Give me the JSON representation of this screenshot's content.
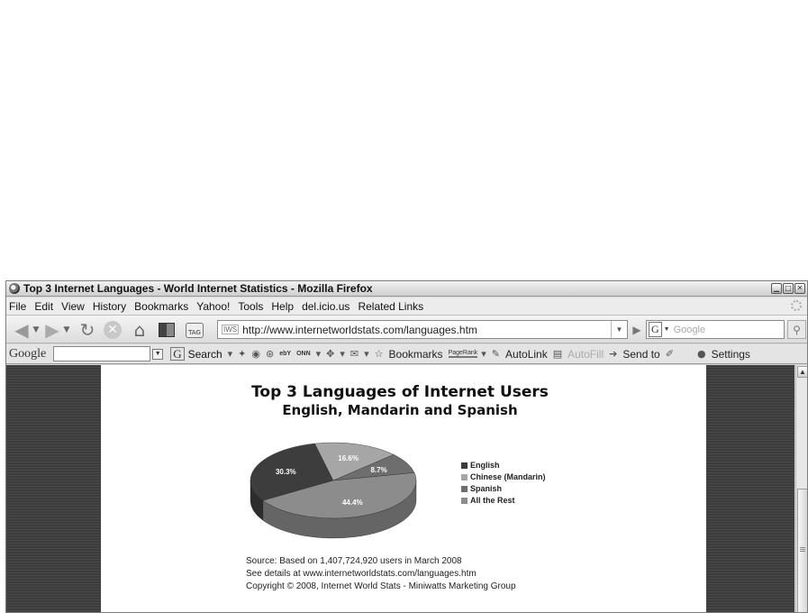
{
  "window": {
    "title": "Top 3 Internet Languages - World Internet Statistics - Mozilla Firefox",
    "buttons": [
      "minimize",
      "maximize",
      "close"
    ]
  },
  "menubar": {
    "items": [
      "File",
      "Edit",
      "View",
      "History",
      "Bookmarks",
      "Yahoo!",
      "Tools",
      "Help",
      "del.icio.us",
      "Related Links"
    ]
  },
  "navbar": {
    "site_icon": "IWS",
    "url": "http://www.internetworldstats.com/languages.htm",
    "search_engine": "G",
    "search_placeholder": "Google",
    "tag_label": "TAG"
  },
  "google_toolbar": {
    "logo": "Google",
    "search_label": "Search",
    "ebay_label": "ebY",
    "onn_label": "ONN",
    "bookmarks_label": "Bookmarks",
    "pagerank_label": "PageRank",
    "autolink_label": "AutoLink",
    "autofill_label": "AutoFill",
    "sendto_label": "Send to",
    "settings_label": "Settings"
  },
  "page": {
    "title": "Top 3 Languages of Internet Users",
    "subtitle": "English, Mandarin and Spanish",
    "source_lines": [
      "Source: Based on 1,407,724,920 users in March 2008",
      "See details at www.internetworldstats.com/languages.htm",
      "Copyright © 2008, Internet World Stats - Miniwatts Marketing Group"
    ]
  },
  "chart_data": {
    "type": "pie",
    "title": "Top 3 Languages of Internet Users",
    "subtitle": "English, Mandarin and Spanish",
    "categories": [
      "English",
      "Chinese (Mandarin)",
      "Spanish",
      "All the Rest"
    ],
    "values": [
      30.3,
      16.6,
      8.7,
      44.4
    ],
    "labels": [
      "30.3%",
      "16.6%",
      "8.7%",
      "44.4%"
    ],
    "colors": [
      "#3d3d3d",
      "#a6a6a6",
      "#6e6e6e",
      "#8c8c8c"
    ],
    "legend_position": "right",
    "style": "3d"
  }
}
